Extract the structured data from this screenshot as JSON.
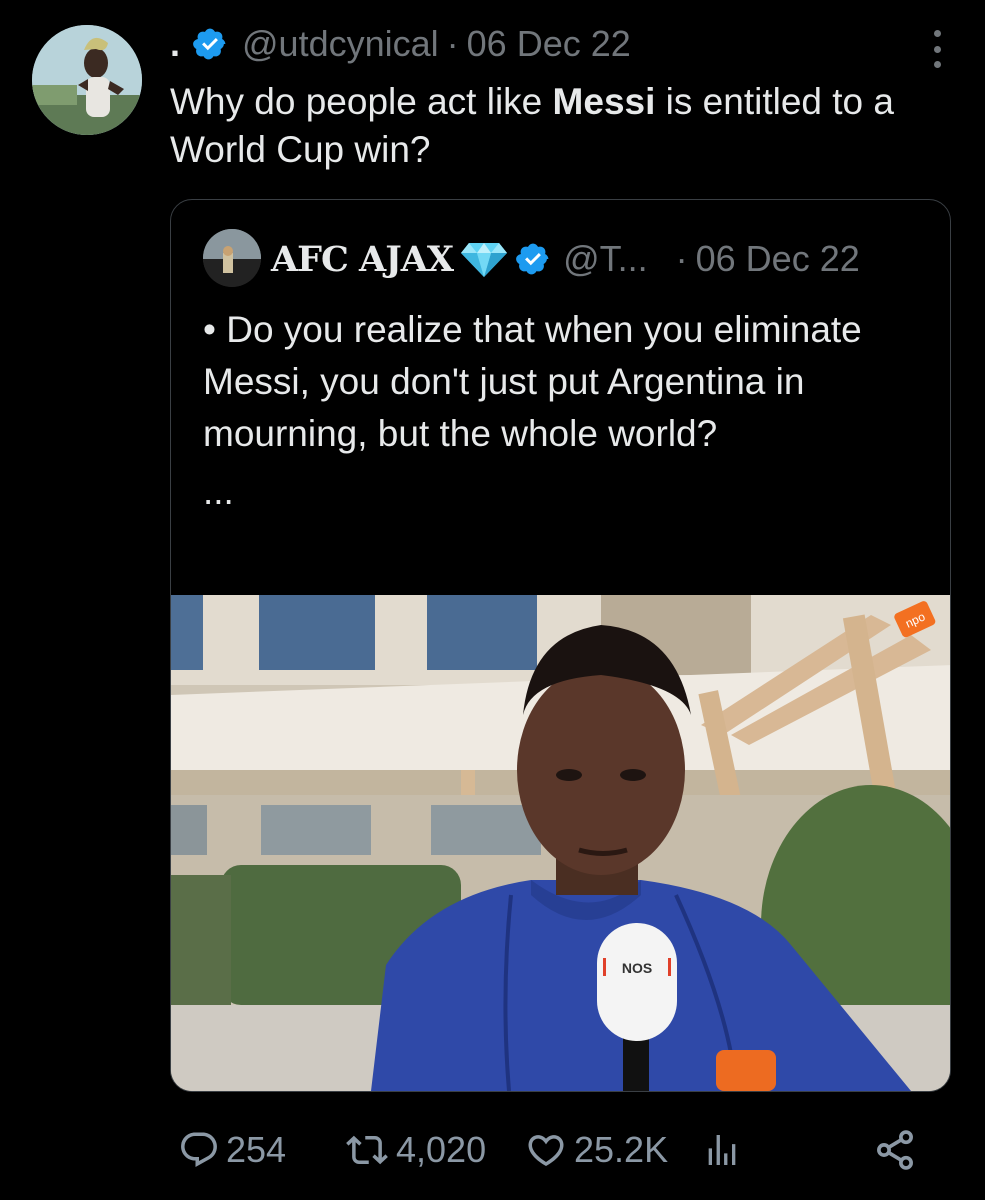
{
  "tweet": {
    "display_name": ".",
    "handle": "@utdcynical",
    "separator": "·",
    "date": "06 Dec 22",
    "text_before": "Why do people act like ",
    "text_bold": "Messi",
    "text_after": " is entitled to a World Cup win?"
  },
  "quoted_tweet": {
    "display_name": "AFC AJAX",
    "handle": "@T...",
    "separator": "·",
    "date": "06 Dec 22",
    "text": "• Do you realize that when you eliminate Messi, you don't just put Argentina in mourning, but the whole world?",
    "ellipsis": "...",
    "media": {
      "broadcaster_logo": "npo",
      "mic_flag": "NOS"
    }
  },
  "actions": {
    "replies": "254",
    "retweets": "4,020",
    "likes": "25.2K"
  },
  "icons": {
    "verified": "verified-badge-icon",
    "gem": "gem-icon",
    "more": "more-icon",
    "reply": "reply-icon",
    "retweet": "retweet-icon",
    "like": "like-icon",
    "views": "views-icon",
    "share": "share-icon"
  },
  "colors": {
    "background": "#000000",
    "text_primary": "#e7e9ea",
    "text_secondary": "#71767b",
    "verified_blue": "#1d9bf0",
    "border": "#3a3f44"
  }
}
